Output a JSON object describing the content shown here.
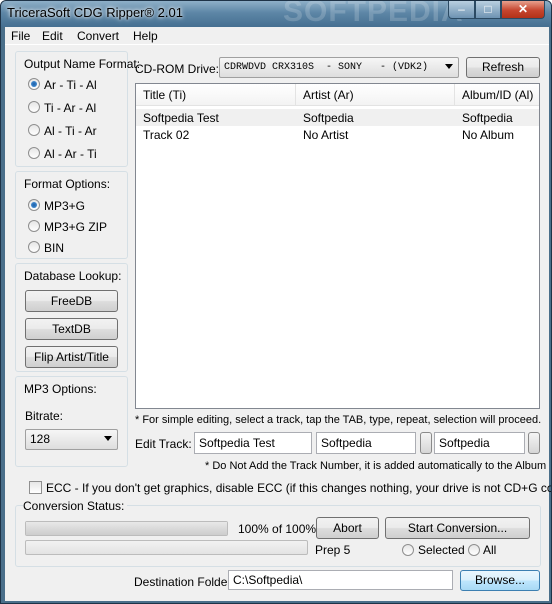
{
  "window": {
    "title": "TriceraSoft CDG Ripper® 2.01",
    "watermark": "SOFTPEDIA"
  },
  "menu": [
    "File",
    "Edit",
    "Convert",
    "Help"
  ],
  "output_name_format": {
    "label": "Output Name Format:",
    "options": [
      "Ar - Ti - Al",
      "Ti - Ar - Al",
      "Al - Ti - Ar",
      "Al - Ar - Ti"
    ],
    "selected_index": 0
  },
  "format_options": {
    "label": "Format Options:",
    "options": [
      "MP3+G",
      "MP3+G ZIP",
      "BIN"
    ],
    "selected_index": 0
  },
  "database_lookup": {
    "label": "Database Lookup:",
    "buttons": [
      "FreeDB",
      "TextDB",
      "Flip Artist/Title"
    ]
  },
  "mp3_options": {
    "label": "MP3 Options:",
    "bitrate_label": "Bitrate:",
    "bitrate_value": "128"
  },
  "cdrom": {
    "label": "CD-ROM Drive:",
    "drive_value": "CDRWDVD CRX310S  - SONY   - (VDK2)",
    "refresh_label": "Refresh"
  },
  "track_list": {
    "columns": [
      "Title (Ti)",
      "Artist (Ar)",
      "Album/ID (Al)"
    ],
    "rows": [
      {
        "title": "Softpedia Test",
        "artist": "Softpedia",
        "album": "Softpedia",
        "selected": true
      },
      {
        "title": "Track 02",
        "artist": "No Artist",
        "album": "No Album",
        "selected": false
      }
    ]
  },
  "hint_editing": "* For simple editing, select a track, tap the TAB, type, repeat, selection will proceed.",
  "edit_track": {
    "label": "Edit Track:",
    "title_value": "Softpedia Test",
    "artist_value": "Softpedia",
    "album_value": "Softpedia"
  },
  "hint_track_number": "* Do Not Add the Track Number, it is added automatically to the Album",
  "ecc": {
    "label": "ECC - If you don't get graphics, disable ECC (if this changes nothing, your drive is not CD+G compatible)",
    "checked": false
  },
  "conversion": {
    "status_label": "Conversion Status:",
    "percent_text": "100% of 100%",
    "progress_value": 1.0,
    "step_text": "Prep 5",
    "abort_label": "Abort",
    "start_label": "Start Conversion...",
    "scope_options": [
      "Selected",
      "All"
    ],
    "scope_selected_index": -1
  },
  "destination": {
    "label": "Destination Folder:",
    "value": "C:\\Softpedia\\",
    "browse_label": "Browse..."
  }
}
